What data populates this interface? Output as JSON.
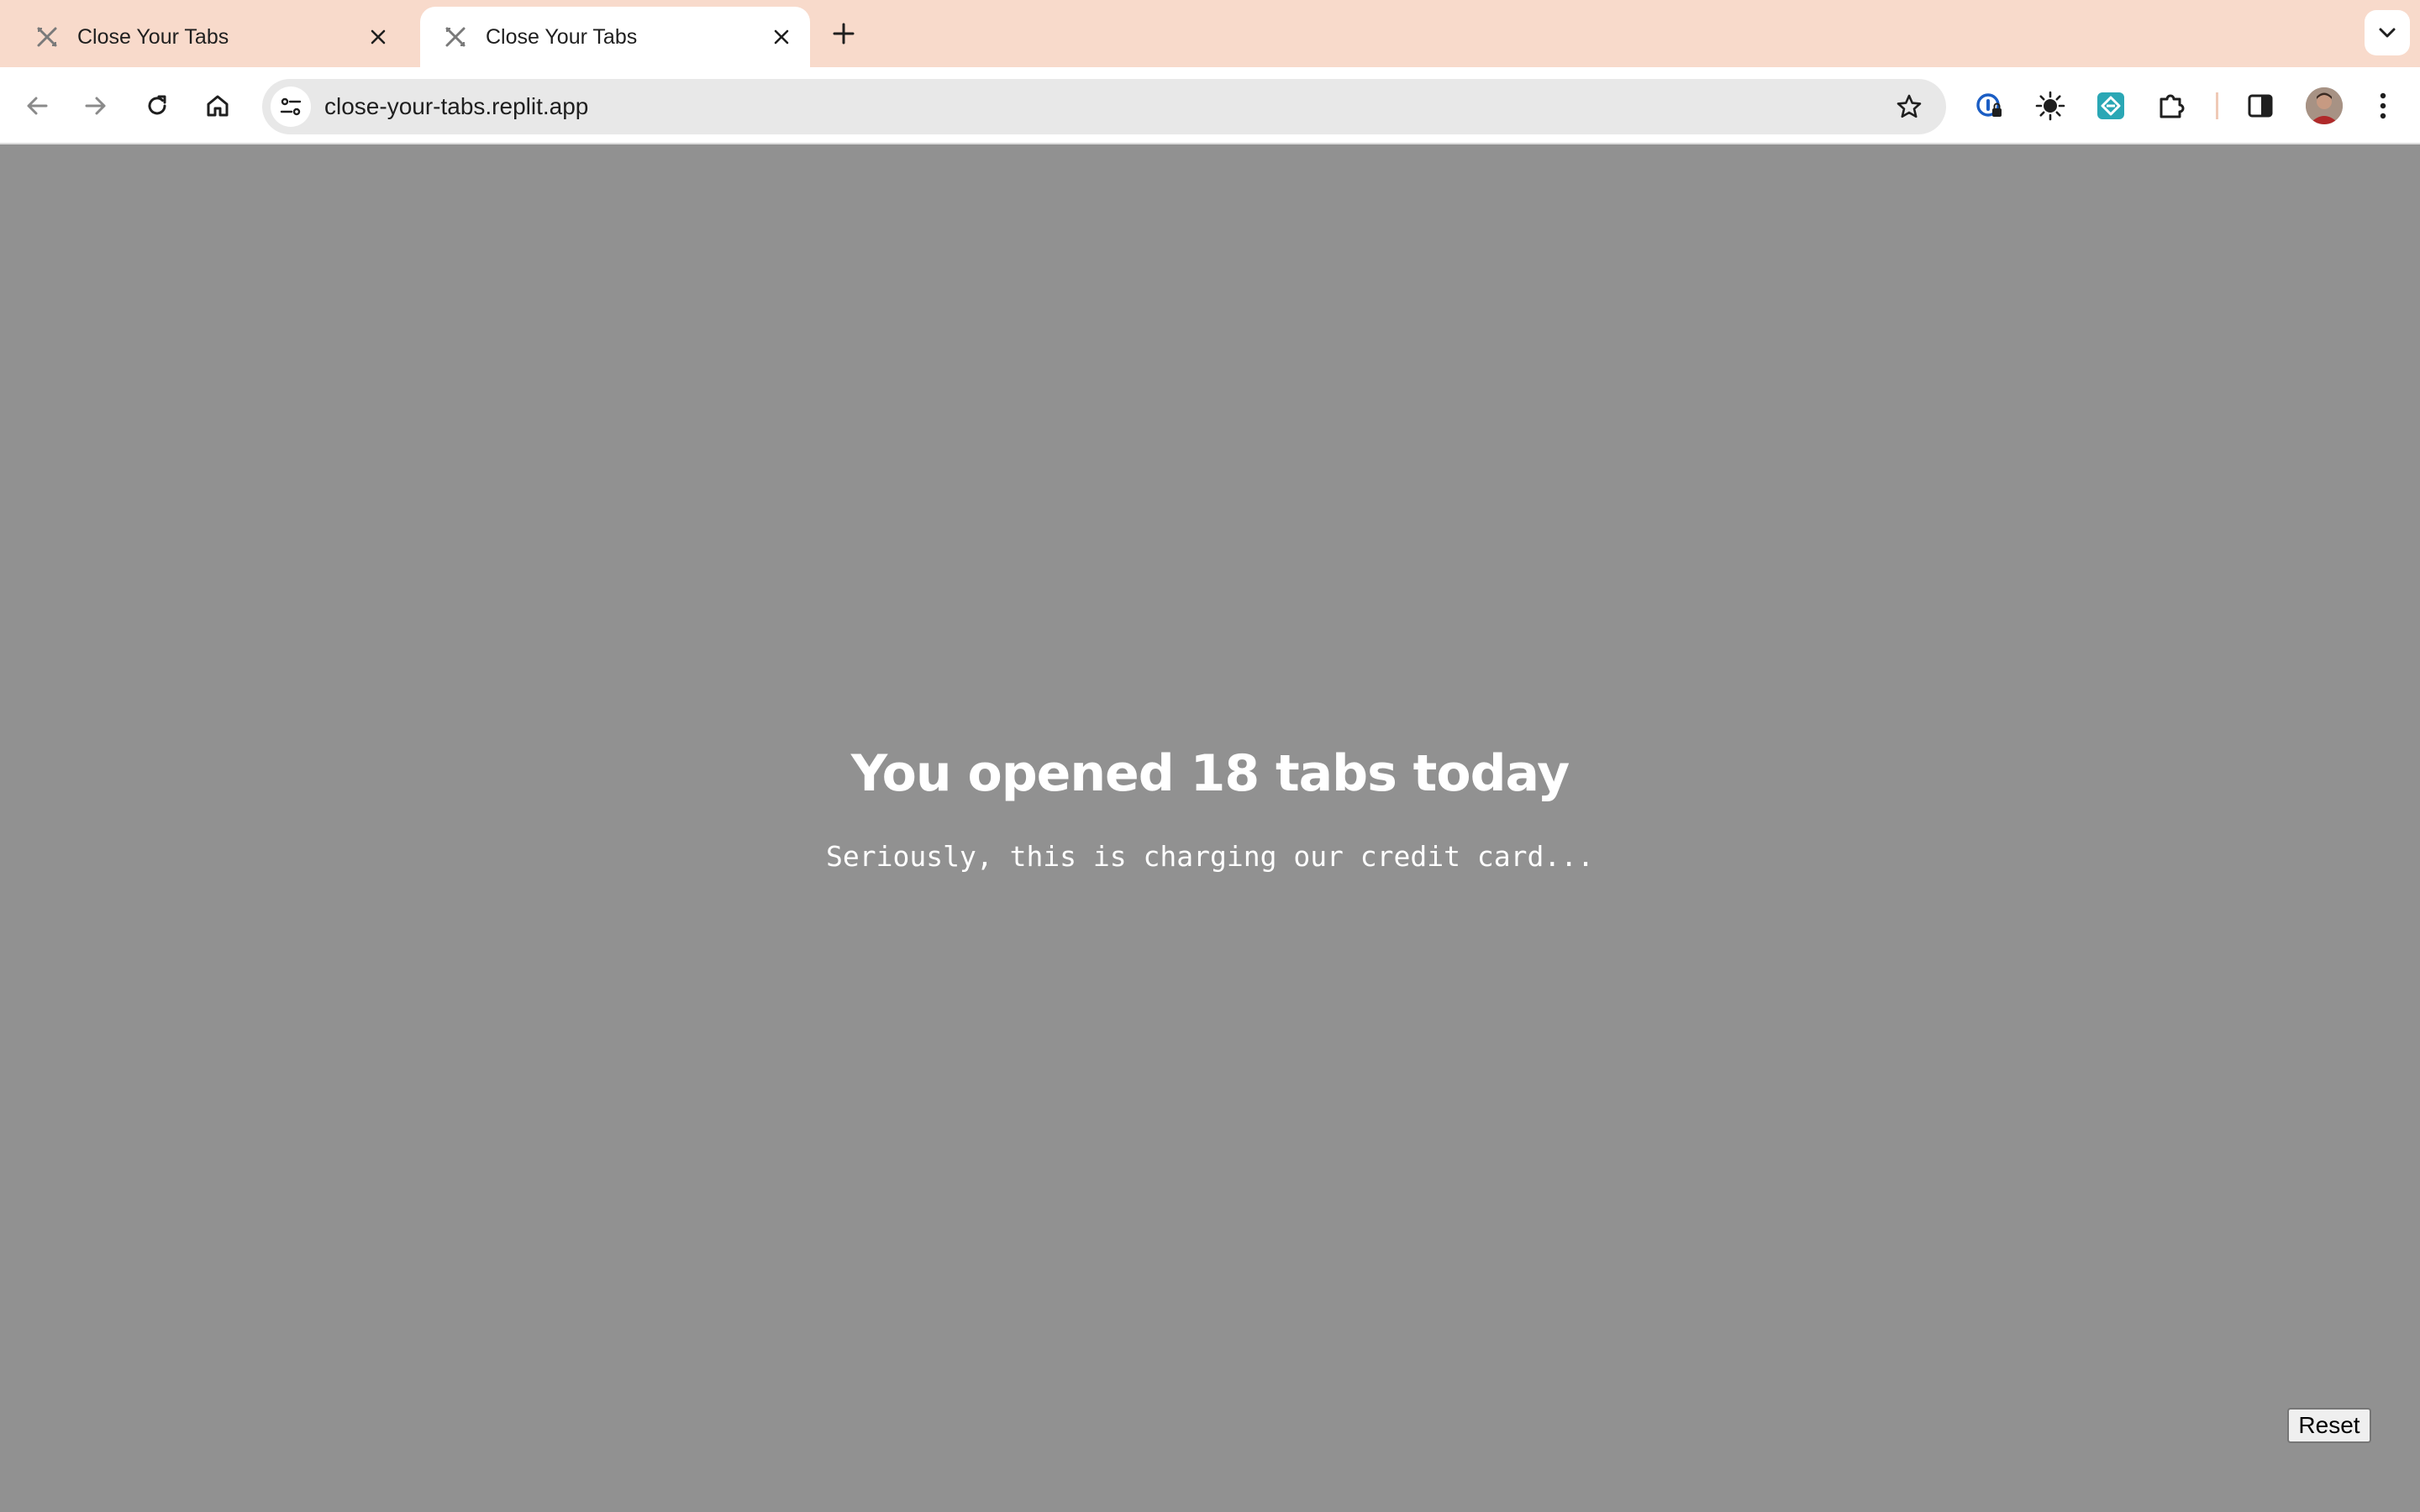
{
  "browser": {
    "tabs": [
      {
        "title": "Close Your Tabs",
        "active": false
      },
      {
        "title": "Close Your Tabs",
        "active": true
      }
    ],
    "url": "close-your-tabs.replit.app",
    "colors": {
      "tab_strip": "#f8dacb",
      "page_background": "#919191"
    }
  },
  "page": {
    "headline": "You opened 18 tabs today",
    "subline": "Seriously, this is charging our credit card...",
    "reset_label": "Reset"
  }
}
